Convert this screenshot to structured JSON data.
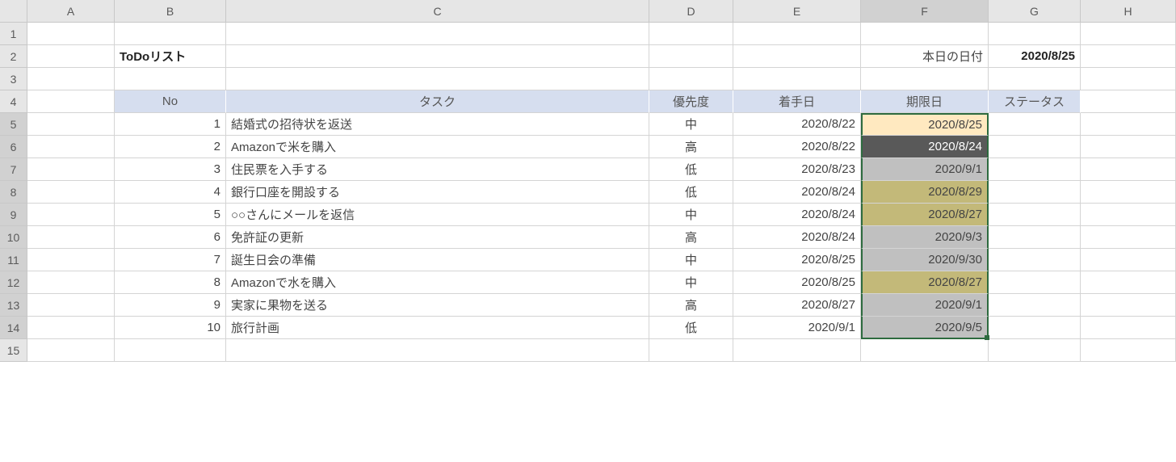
{
  "columns": [
    "A",
    "B",
    "C",
    "D",
    "E",
    "F",
    "G",
    "H"
  ],
  "rows": [
    "1",
    "2",
    "3",
    "4",
    "5",
    "6",
    "7",
    "8",
    "9",
    "10",
    "11",
    "12",
    "13",
    "14",
    "15"
  ],
  "title": "ToDoリスト",
  "today_label": "本日の日付",
  "today_value": "2020/8/25",
  "headers": {
    "no": "No",
    "task": "タスク",
    "priority": "優先度",
    "start": "着手日",
    "due": "期限日",
    "status": "ステータス"
  },
  "chart_data": {
    "type": "table",
    "columns": [
      "No",
      "タスク",
      "優先度",
      "着手日",
      "期限日",
      "ステータス"
    ],
    "rows": [
      {
        "no": "1",
        "task": "結婚式の招待状を返送",
        "priority": "中",
        "start": "2020/8/22",
        "due": "2020/8/25",
        "due_bg": "bg-f1",
        "status": ""
      },
      {
        "no": "2",
        "task": "Amazonで米を購入",
        "priority": "高",
        "start": "2020/8/22",
        "due": "2020/8/24",
        "due_bg": "bg-f2",
        "status": ""
      },
      {
        "no": "3",
        "task": "住民票を入手する",
        "priority": "低",
        "start": "2020/8/23",
        "due": "2020/9/1",
        "due_bg": "bg-f3",
        "status": ""
      },
      {
        "no": "4",
        "task": "銀行口座を開設する",
        "priority": "低",
        "start": "2020/8/24",
        "due": "2020/8/29",
        "due_bg": "bg-f4",
        "status": ""
      },
      {
        "no": "5",
        "task": "○○さんにメールを返信",
        "priority": "中",
        "start": "2020/8/24",
        "due": "2020/8/27",
        "due_bg": "bg-f4",
        "status": ""
      },
      {
        "no": "6",
        "task": "免許証の更新",
        "priority": "高",
        "start": "2020/8/24",
        "due": "2020/9/3",
        "due_bg": "bg-f3",
        "status": ""
      },
      {
        "no": "7",
        "task": "誕生日会の準備",
        "priority": "中",
        "start": "2020/8/25",
        "due": "2020/9/30",
        "due_bg": "bg-f3",
        "status": ""
      },
      {
        "no": "8",
        "task": "Amazonで水を購入",
        "priority": "中",
        "start": "2020/8/25",
        "due": "2020/8/27",
        "due_bg": "bg-f4",
        "status": ""
      },
      {
        "no": "9",
        "task": "実家に果物を送る",
        "priority": "高",
        "start": "2020/8/27",
        "due": "2020/9/1",
        "due_bg": "bg-f3",
        "status": ""
      },
      {
        "no": "10",
        "task": "旅行計画",
        "priority": "低",
        "start": "2020/9/1",
        "due": "2020/9/5",
        "due_bg": "bg-f3",
        "status": ""
      }
    ]
  }
}
